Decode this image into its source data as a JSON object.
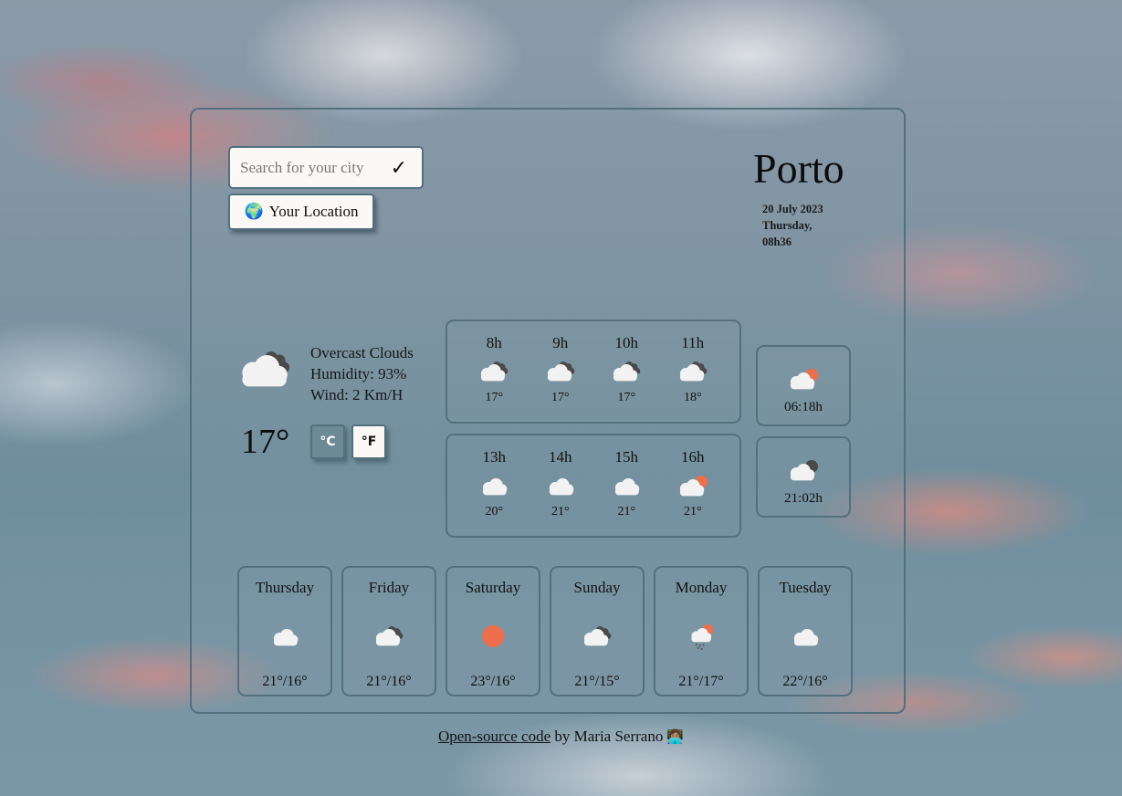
{
  "search": {
    "placeholder": "Search for your city",
    "value": "",
    "submit_icon": "check-icon",
    "submit_glyph": "✓"
  },
  "location_button": {
    "icon": "globe-icon",
    "glyph": "🌍",
    "label": "Your Location"
  },
  "city": {
    "name": "Porto",
    "date": "20 July 2023",
    "weekday": "Thursday,",
    "time": "08h36"
  },
  "current": {
    "icon": "overcast-clouds-icon",
    "description": "Overcast Clouds",
    "humidity": "Humidity: 93%",
    "wind": "Wind: 2 Km/H",
    "temperature": "17°",
    "units": {
      "celsius_label": "°C",
      "fahrenheit_label": "°F",
      "active": "celsius"
    }
  },
  "hourly": [
    {
      "hour": "8h",
      "icon": "overcast",
      "temp": "17°"
    },
    {
      "hour": "9h",
      "icon": "overcast",
      "temp": "17°"
    },
    {
      "hour": "10h",
      "icon": "overcast",
      "temp": "17°"
    },
    {
      "hour": "11h",
      "icon": "overcast",
      "temp": "18°"
    },
    {
      "hour": "13h",
      "icon": "cloud",
      "temp": "20°"
    },
    {
      "hour": "14h",
      "icon": "cloud",
      "temp": "21°"
    },
    {
      "hour": "15h",
      "icon": "cloud",
      "temp": "21°"
    },
    {
      "hour": "16h",
      "icon": "partly-sunny",
      "temp": "21°"
    }
  ],
  "sun": {
    "sunrise": {
      "icon": "sunrise",
      "time": "06:18h"
    },
    "sunset": {
      "icon": "sunset",
      "time": "21:02h"
    }
  },
  "daily": [
    {
      "day": "Thursday",
      "icon": "cloud",
      "temps": "21°/16°"
    },
    {
      "day": "Friday",
      "icon": "overcast",
      "temps": "21°/16°"
    },
    {
      "day": "Saturday",
      "icon": "sun",
      "temps": "23°/16°"
    },
    {
      "day": "Sunday",
      "icon": "overcast",
      "temps": "21°/15°"
    },
    {
      "day": "Monday",
      "icon": "rain-sun",
      "temps": "21°/17°"
    },
    {
      "day": "Tuesday",
      "icon": "cloud",
      "temps": "22°/16°"
    }
  ],
  "footer": {
    "link_text": "Open-source code",
    "by_text": " by Maria Serrano",
    "emoji": "👩🏽‍💻"
  },
  "colors": {
    "border": "#52707e",
    "sun": "#ee6e4c",
    "cloud": "#f2f2f2",
    "dark_cloud": "#4a4a4a",
    "button_bg": "#fcf8f5",
    "active_unit_bg": "#6d8996"
  }
}
